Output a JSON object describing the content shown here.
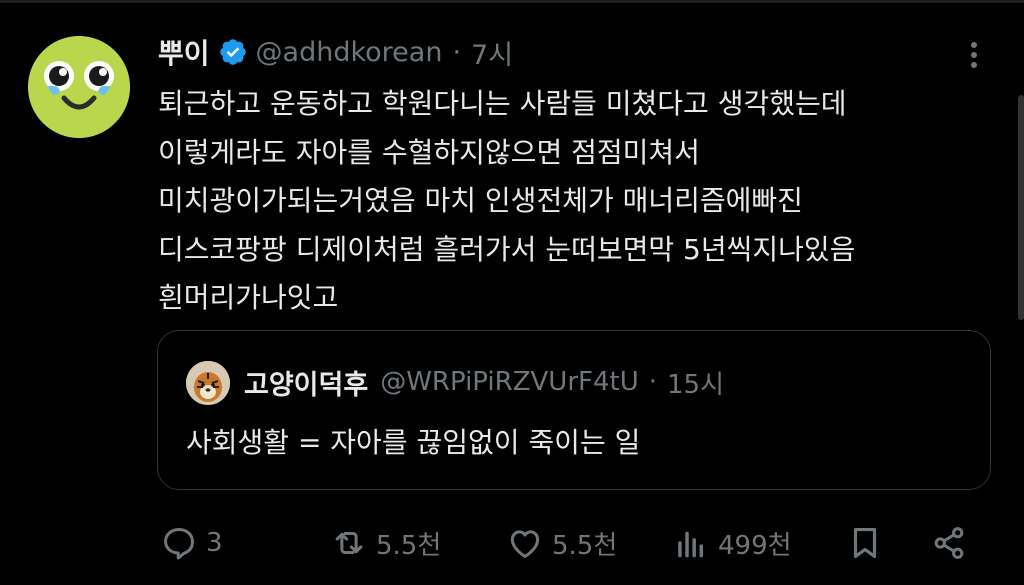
{
  "post": {
    "author_name": "뿌이",
    "handle": "@adhdkorean",
    "separator": "·",
    "time": "7시",
    "lines": [
      "퇴근하고 운동하고 학원다니는 사람들 미쳤다고 생각했는데",
      "이렇게라도 자아를 수혈하지않으면 점점미쳐서",
      "미치광이가되는거였음 마치 인생전체가 매너리즘에빠진",
      "디스코팡팡 디제이처럼 흘러가서 눈떠보면막 5년씩지나있음",
      "흰머리가나잇고"
    ]
  },
  "quote": {
    "author_name": "고양이덕후",
    "handle": "@WRPiPiRZVUrF4tU",
    "separator": "·",
    "time": "15시",
    "text": "사회생활 = 자아를 끊임없이 죽이는 일"
  },
  "actions": {
    "reply_count": "3",
    "repost_count": "5.5천",
    "like_count": "5.5천",
    "views_count": "499천"
  },
  "icons": {
    "reply": "reply-icon",
    "repost": "repost-icon",
    "like": "heart-icon",
    "views": "views-icon",
    "bookmark": "bookmark-icon",
    "share": "share-icon",
    "verified": "verified-badge-icon",
    "more": "more-icon"
  },
  "colors": {
    "background": "#000000",
    "text": "#e7e9ea",
    "muted": "#71767b",
    "verified": "#1d9bf0",
    "border": "#2f3336"
  }
}
